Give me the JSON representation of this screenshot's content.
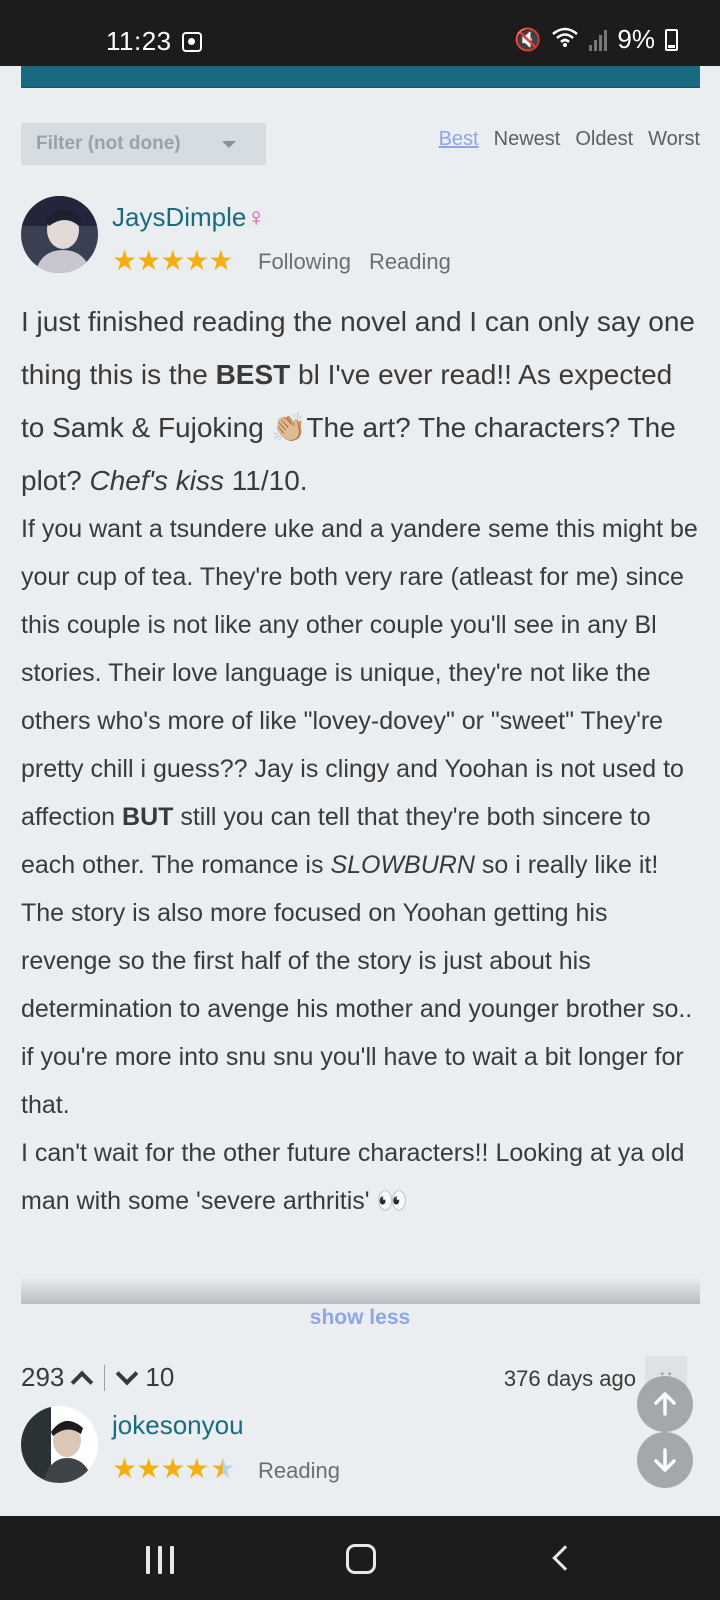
{
  "status_bar": {
    "time": "11:23",
    "battery": "9%",
    "icons": [
      "notification-icon",
      "mute-icon",
      "wifi-icon",
      "signal-icon",
      "battery-icon"
    ]
  },
  "filter": {
    "label": "Filter (not done)"
  },
  "sort_tabs": [
    {
      "label": "Best",
      "active": true
    },
    {
      "label": "Newest",
      "active": false
    },
    {
      "label": "Oldest",
      "active": false
    },
    {
      "label": "Worst",
      "active": false
    }
  ],
  "comment1": {
    "username": "JaysDimple",
    "gender_symbol": "♀",
    "rating": 5,
    "stars": "★★★★★",
    "tags": [
      "Following",
      "Reading"
    ],
    "body": {
      "p1_a": "I just finished reading the novel and I can only say one thing this is the ",
      "p1_b": "BEST",
      "p1_c": " bl I've ever read!! As expected to Samk & Fujoking 👏🏼The art? The characters? The plot? ",
      "p1_d": "Chef's kiss",
      "p1_e": " 11/10.",
      "p2_a": "If you want a tsundere uke and a yandere seme this might be your cup of tea. They're both very rare (atleast for me) since this couple is not like any other couple you'll see in any Bl stories. Their love language is unique, they're not like the others who's more of like \"lovey-dovey\" or \"sweet\" They're pretty chill i guess?? Jay is clingy and Yoohan is not used to affection ",
      "p2_b": "BUT",
      "p2_c": " still you can tell that they're both sincere to each other. The romance is ",
      "p2_d": "SLOWBURN",
      "p2_e": " so i really like it! The story is also more focused on Yoohan getting his revenge so the first half of the story is just about his determination to avenge his mother and younger brother so.. if you're more into snu snu you'll have to wait a bit longer for that.",
      "p3": "I can't wait for the other future characters!! Looking at ya old man with some 'severe arthritis' 👀"
    },
    "show_less": "show less",
    "upvotes": "293",
    "downvotes": "10",
    "date": "376 days ago",
    "more": "··"
  },
  "comment2": {
    "username": "jokesonyou",
    "rating": 4.5,
    "stars": "★★★★",
    "half_star": "★",
    "tags": [
      "Reading"
    ]
  },
  "colors": {
    "accent": "#1a6b7e",
    "link": "#8fa6e6",
    "star": "#f2b016",
    "background": "#eaeef1"
  }
}
